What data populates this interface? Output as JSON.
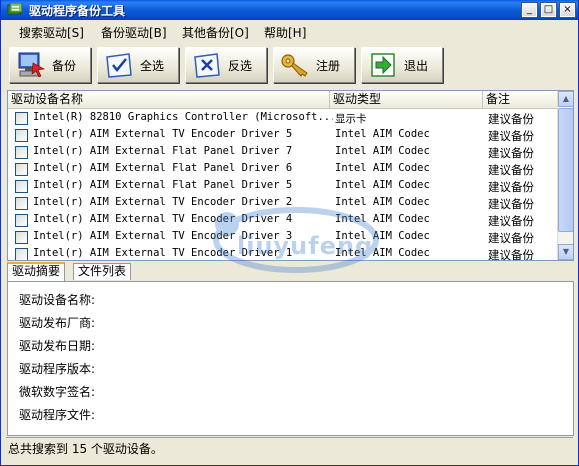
{
  "window": {
    "title": "驱动程序备份工具",
    "min_label": "_",
    "max_label": "□",
    "close_label": "×"
  },
  "menu": {
    "items": [
      "搜索驱动[S]",
      "备份驱动[B]",
      "其他备份[O]",
      "帮助[H]"
    ]
  },
  "toolbar": {
    "backup_label": "备份",
    "select_all_label": "全选",
    "invert_label": "反选",
    "register_label": "注册",
    "exit_label": "退出"
  },
  "list": {
    "columns": [
      "驱动设备名称",
      "驱动类型",
      "备注"
    ],
    "rows": [
      {
        "name": "Intel(R) 82810 Graphics Controller (Microsoft...",
        "type": "显示卡",
        "note": "建议备份"
      },
      {
        "name": "Intel(r) AIM External TV Encoder Driver 5",
        "type": "Intel AIM Codec",
        "note": "建议备份"
      },
      {
        "name": "Intel(r) AIM External Flat Panel Driver 7",
        "type": "Intel AIM Codec",
        "note": "建议备份"
      },
      {
        "name": "Intel(r) AIM External Flat Panel Driver 6",
        "type": "Intel AIM Codec",
        "note": "建议备份"
      },
      {
        "name": "Intel(r) AIM External Flat Panel Driver 5",
        "type": "Intel AIM Codec",
        "note": "建议备份"
      },
      {
        "name": "Intel(r) AIM External TV Encoder Driver 2",
        "type": "Intel AIM Codec",
        "note": "建议备份"
      },
      {
        "name": "Intel(r) AIM External TV Encoder Driver 4",
        "type": "Intel AIM Codec",
        "note": "建议备份"
      },
      {
        "name": "Intel(r) AIM External TV Encoder Driver 3",
        "type": "Intel AIM Codec",
        "note": "建议备份"
      },
      {
        "name": "Intel(r) AIM External TV Encoder Driver 1",
        "type": "Intel AIM Codec",
        "note": "建议备份"
      }
    ]
  },
  "tabs": [
    "驱动摘要",
    "文件列表"
  ],
  "detail": {
    "device_name_label": "驱动设备名称:",
    "vendor_label": "驱动发布厂商:",
    "date_label": "驱动发布日期:",
    "version_label": "驱动程序版本:",
    "signature_label": "微软数字签名:",
    "file_label": "驱动程序文件:"
  },
  "status": {
    "message": "总共搜索到 15 个驱动设备。"
  },
  "watermark": "liuyufeng",
  "colors": {
    "titlebar": "#0b5ed7",
    "window_bg": "#ece9d8",
    "tab_accent": "#f2a63c"
  }
}
